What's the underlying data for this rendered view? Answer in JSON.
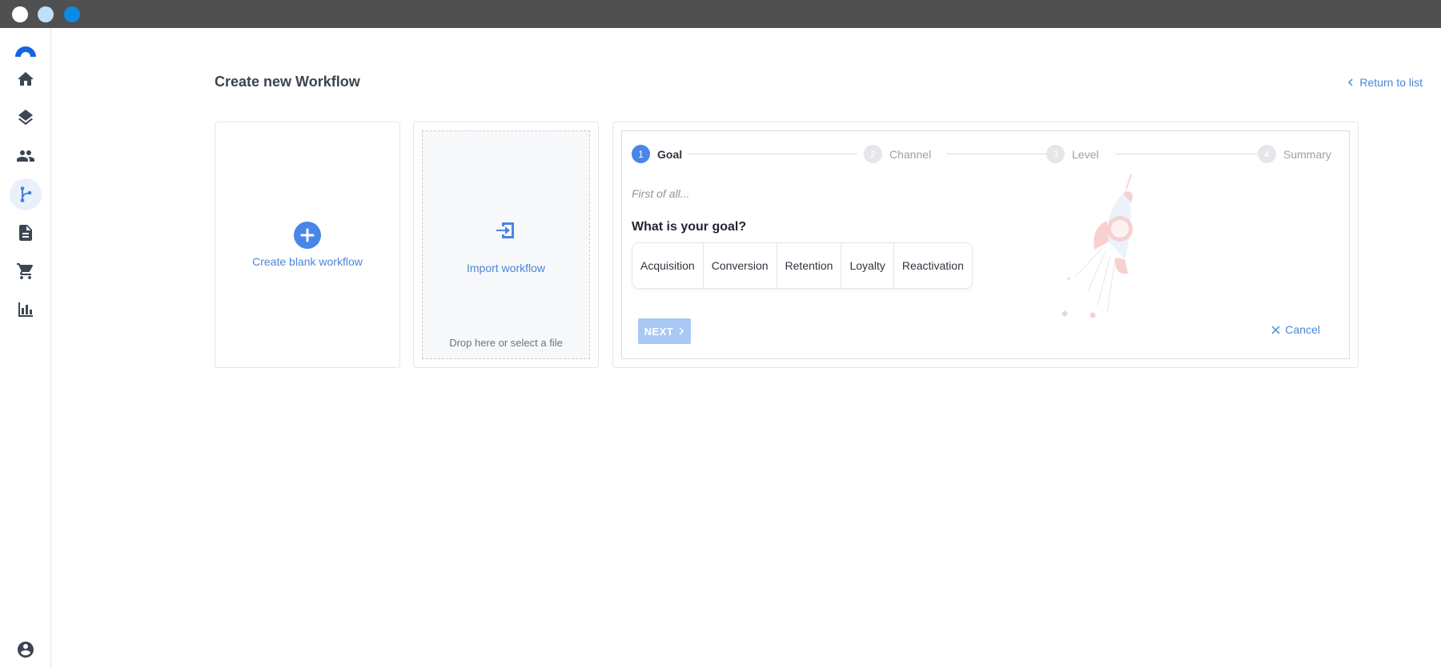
{
  "window": {
    "controls": [
      "close-dot",
      "minimize-dot",
      "maximize-dot"
    ]
  },
  "sidebar": {
    "items": [
      {
        "name": "home",
        "icon": "home-icon",
        "active": false
      },
      {
        "name": "layers",
        "icon": "layers-icon",
        "active": false
      },
      {
        "name": "users",
        "icon": "users-icon",
        "active": false
      },
      {
        "name": "workflows",
        "icon": "workflow-icon",
        "active": true
      },
      {
        "name": "documents",
        "icon": "document-icon",
        "active": false
      },
      {
        "name": "cart",
        "icon": "cart-icon",
        "active": false
      },
      {
        "name": "reports",
        "icon": "bar-chart-icon",
        "active": false
      }
    ],
    "footer_icon": "account-circle-icon"
  },
  "header": {
    "title": "Create new Workflow",
    "return_label": "Return to list"
  },
  "blank_card": {
    "label": "Create blank workflow"
  },
  "import_card": {
    "label": "Import workflow",
    "drop_hint": "Drop here or select a file"
  },
  "wizard": {
    "steps": [
      {
        "number": "1",
        "label": "Goal",
        "active": true
      },
      {
        "number": "2",
        "label": "Channel",
        "active": false
      },
      {
        "number": "3",
        "label": "Level",
        "active": false
      },
      {
        "number": "4",
        "label": "Summary",
        "active": false
      }
    ],
    "intro": "First of all...",
    "question": "What is your goal?",
    "options": [
      "Acquisition",
      "Conversion",
      "Retention",
      "Loyalty",
      "Reactivation"
    ],
    "next_label": "NEXT",
    "cancel_label": "Cancel"
  },
  "colors": {
    "accent": "#4a86e8",
    "link": "#4a86d8",
    "next_disabled": "#a9c8f5",
    "titlebar": "#505050"
  }
}
